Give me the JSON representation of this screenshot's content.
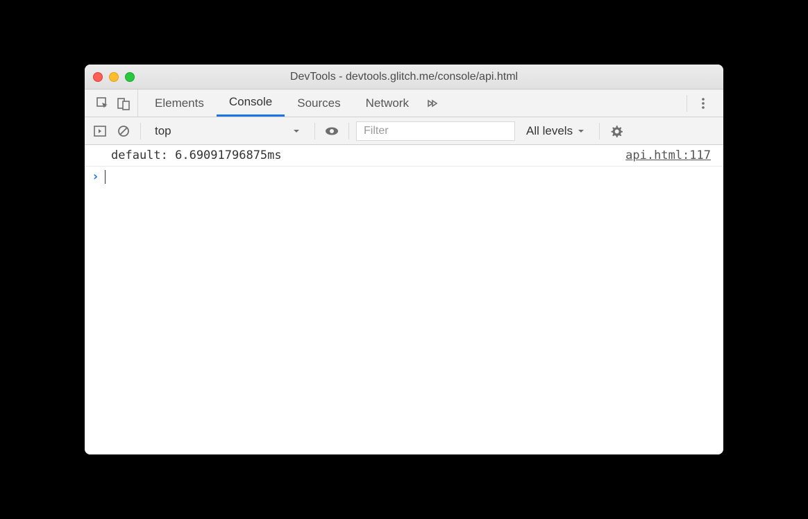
{
  "window": {
    "title": "DevTools - devtools.glitch.me/console/api.html"
  },
  "tabs": {
    "elements": "Elements",
    "console": "Console",
    "sources": "Sources",
    "network": "Network"
  },
  "filterbar": {
    "context": "top",
    "filter_placeholder": "Filter",
    "levels": "All levels"
  },
  "console": {
    "log_message": "default: 6.69091796875ms",
    "source_link": "api.html:117",
    "prompt_symbol": "›"
  }
}
